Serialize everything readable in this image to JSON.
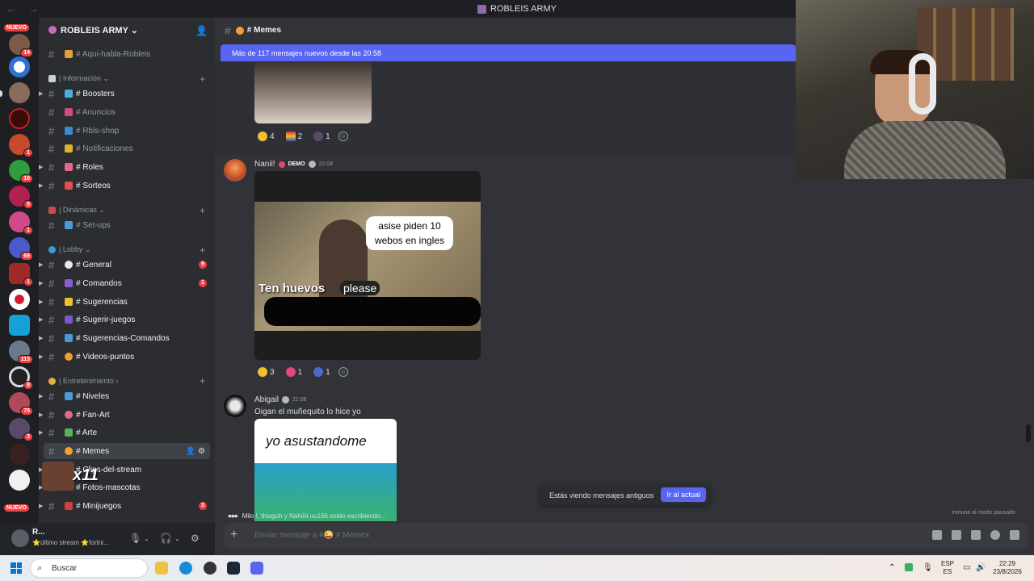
{
  "titlebar": {
    "title": "ROBLEIS ARMY",
    "nav": "← →"
  },
  "guilds": {
    "nuevo_label": "NUEVO",
    "nuevo_bottom_label": "NUEVO",
    "badges": [
      "14",
      "1",
      "10",
      "5",
      "1",
      "69",
      "1",
      "113",
      "8",
      "75",
      "3"
    ]
  },
  "server": {
    "name": "ROBLEIS ARMY ⌄"
  },
  "channels": {
    "top": {
      "name": "# Aqui-habla-Robleis"
    },
    "cat_info": "| Información ⌄",
    "info": [
      {
        "name": "# Boosters"
      },
      {
        "name": "# Anuncios"
      },
      {
        "name": "# Rbls-shop"
      },
      {
        "name": "# Notificaciones"
      },
      {
        "name": "# Roles"
      },
      {
        "name": "# Sorteos"
      }
    ],
    "cat_dinamicas": "| Dinámicas ⌄",
    "dinamicas": [
      {
        "name": "# Set-ups"
      }
    ],
    "cat_lobby": "| Lobby ⌄",
    "lobby": [
      {
        "name": "# General",
        "mention": "9"
      },
      {
        "name": "# Comandos",
        "mention": "1"
      },
      {
        "name": "# Sugerencias"
      },
      {
        "name": "# Sugerir-juegos"
      },
      {
        "name": "# Sugerencias-Comandos"
      },
      {
        "name": "# Videos-puntos"
      }
    ],
    "cat_entretenimiento": "| Entretenimiento ›",
    "entretenimiento": [
      {
        "name": "# Niveles"
      },
      {
        "name": "# Fan-Art"
      },
      {
        "name": "# Arte"
      },
      {
        "name": "# Memes"
      },
      {
        "name": "# Clips-del-stream"
      },
      {
        "name": "# Fotos-mascotas"
      },
      {
        "name": "# Minijuegos",
        "mention": "3"
      }
    ],
    "overlay_text": "x11"
  },
  "user": {
    "name": "R...",
    "status": "⭐último stream ⭐fortni..."
  },
  "chat": {
    "channel": "# Memes",
    "new_messages_bar": "Más de 117 mensajes nuevos desde las 20:58",
    "msg1_reactions": [
      "4",
      "2",
      "1"
    ],
    "msg2": {
      "author": "Nanii!",
      "tag": "DEMO",
      "time": "22:08",
      "caption1": "asise piden 10 webos en ingles",
      "caption2": "Ten huevos",
      "caption3": "please",
      "reactions": [
        "3",
        "1",
        "1"
      ]
    },
    "msg3": {
      "author": "Abigail",
      "time": "22:08",
      "text": "Oigan el muñequito lo hice yo",
      "image_caption": "yo asustandome"
    },
    "typing": "Milo !, thiaguh y Nahiiiii.uu166 están escribiendo...",
    "immune": "Inmune al modo pausado",
    "old_messages": "Estás viendo mensajes antiguos",
    "jump_button": "Ir al actual",
    "composer_placeholder": "Enviar mensaje a #😜 # Memes"
  },
  "taskbar": {
    "search_placeholder": "Buscar",
    "lang_top": "ESP",
    "lang_bottom": "ES",
    "time": "22:29",
    "date": "23/8/2026"
  }
}
